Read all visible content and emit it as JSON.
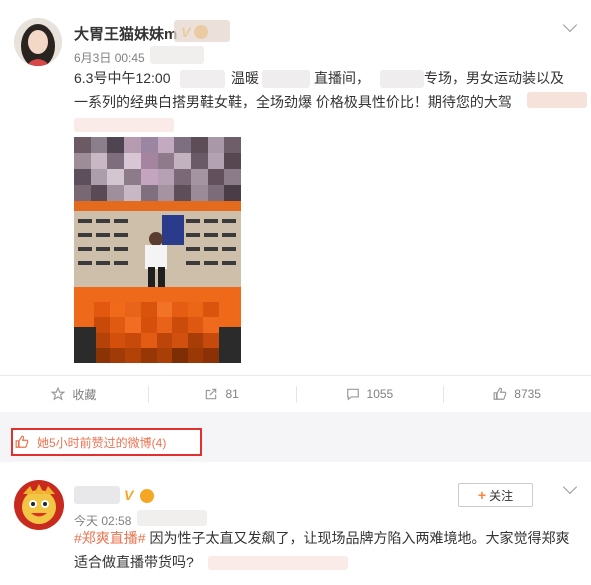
{
  "post1": {
    "author": "大胃王猫妹妹m",
    "date": "6月3日",
    "time": "00:45",
    "verified_badge": "V",
    "text_line1_a": "6.3号中午12:00",
    "text_line1_b": "温暖",
    "text_line1_c": "直播间，",
    "text_line1_d": "专场，男女运动装以及",
    "text_line2": "一系列的经典白搭男鞋女鞋，全场劲爆 价格极具性价比！期待您的大驾",
    "actions": {
      "collect_label": "收藏",
      "share_count": "81",
      "comment_count": "1055",
      "like_count": "8735"
    }
  },
  "liked_notice": {
    "text": "她5小时前赞过的微博(4)"
  },
  "post2": {
    "date_prefix": "今天",
    "time": "02:58",
    "follow_label": "关注",
    "hashtag": "#郑爽直播#",
    "text_line1": "因为性子太直又发飙了，让现场品牌方陷入两难境地。大家觉得郑爽",
    "text_line2": "适合做直播带货吗?",
    "verified_badge": "V"
  },
  "colors": {
    "accent_orange": "#eb7350",
    "highlight_red": "#e03030",
    "verified_gold": "#f5a623"
  },
  "icons": [
    "avatar",
    "verified-icon",
    "vip-icon",
    "chevron-down-icon",
    "star-icon",
    "share-icon",
    "comment-icon",
    "thumb-up-icon"
  ]
}
